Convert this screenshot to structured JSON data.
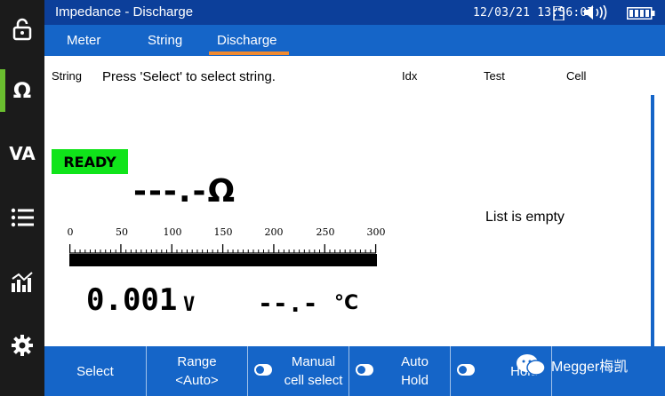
{
  "window": {
    "title": "Impedance - Discharge",
    "datetime": "12/03/21  13:56:07"
  },
  "sidebar": {
    "items": [
      {
        "icon": "unlock-icon",
        "label": ""
      },
      {
        "icon": "ohm-icon",
        "label": "Ω"
      },
      {
        "icon": "va-icon",
        "label": "VA"
      },
      {
        "icon": "list-icon",
        "label": ""
      },
      {
        "icon": "chart-icon",
        "label": ""
      },
      {
        "icon": "gear-icon",
        "label": ""
      }
    ]
  },
  "tabs": [
    {
      "label": "Meter"
    },
    {
      "label": "String"
    },
    {
      "label": "Discharge"
    }
  ],
  "content": {
    "string_label": "String",
    "instruction": "Press 'Select' to select string.",
    "col_idx": "Idx",
    "col_test": "Test",
    "col_cell": "Cell",
    "status": "READY",
    "impedance_value": "---.-",
    "impedance_unit": "Ω",
    "scale_labels": [
      "0",
      "50",
      "100",
      "150",
      "200",
      "250",
      "300"
    ],
    "voltage_value": "0.001",
    "voltage_unit": "V",
    "temperature_value": "--.-",
    "temperature_unit": "°C",
    "list_empty": "List is empty"
  },
  "bottom": {
    "select": "Select",
    "range_line1": "Range",
    "range_line2": "<Auto>",
    "manual_line1": "Manual",
    "manual_line2": "cell select",
    "auto_line1": "Auto",
    "auto_line2": "Hold",
    "hold": "Hold"
  },
  "watermark": "Megger梅凯",
  "colors": {
    "titlebar": "#0c3f9a",
    "tabbar": "#1565c8",
    "accent": "#f08a30",
    "ready": "#10e41a",
    "active_side": "#6abf2f"
  }
}
